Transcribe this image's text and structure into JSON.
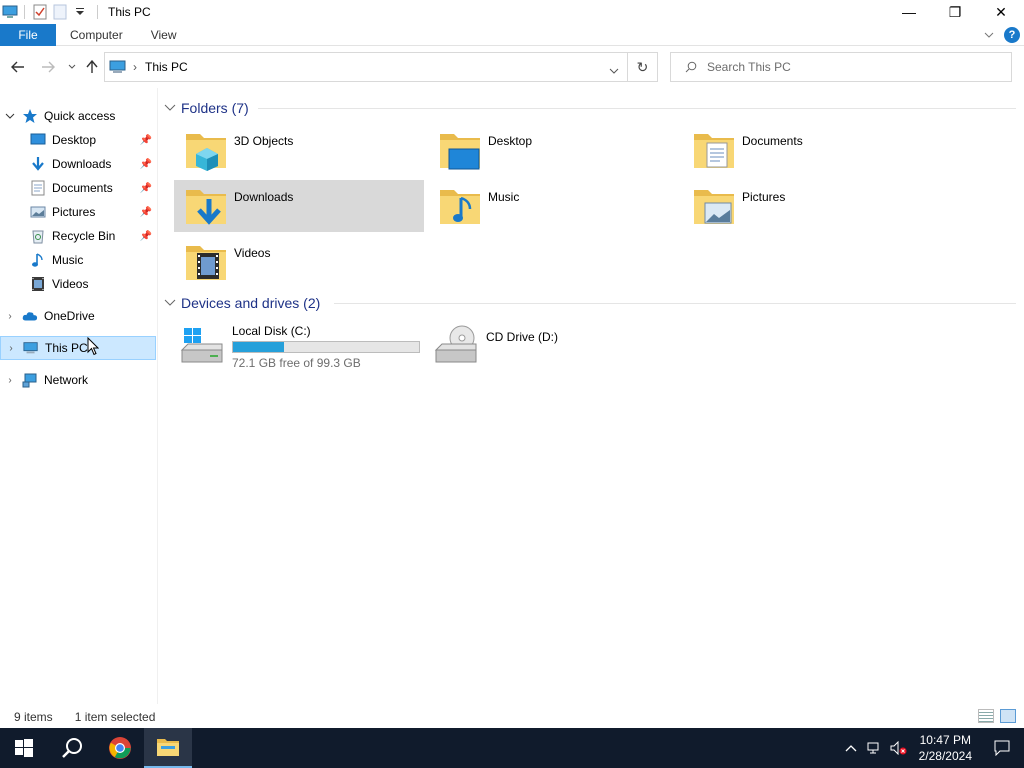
{
  "window": {
    "title": "This PC",
    "controls": {
      "minimize": "—",
      "restore": "❐",
      "close": "✕"
    }
  },
  "ribbon": {
    "tabs": [
      {
        "label": "File"
      },
      {
        "label": "Computer"
      },
      {
        "label": "View"
      }
    ],
    "help": "?"
  },
  "address": {
    "path_segment": "This PC",
    "search_placeholder": "Search This PC"
  },
  "nav": {
    "quick_access": "Quick access",
    "pinned": [
      {
        "label": "Desktop",
        "icon": "desktop-icon",
        "pinned": true
      },
      {
        "label": "Downloads",
        "icon": "downloads-icon",
        "pinned": true
      },
      {
        "label": "Documents",
        "icon": "documents-icon",
        "pinned": true
      },
      {
        "label": "Pictures",
        "icon": "pictures-icon",
        "pinned": true
      },
      {
        "label": "Recycle Bin",
        "icon": "recycle-bin-icon",
        "pinned": true
      },
      {
        "label": "Music",
        "icon": "music-icon",
        "pinned": false
      },
      {
        "label": "Videos",
        "icon": "videos-icon",
        "pinned": false
      }
    ],
    "onedrive": "OneDrive",
    "this_pc": "This PC",
    "network": "Network"
  },
  "content": {
    "folders_header": "Folders (7)",
    "folders": [
      {
        "label": "3D Objects",
        "overlay": "3d-objects-icon"
      },
      {
        "label": "Desktop",
        "overlay": "desktop-icon"
      },
      {
        "label": "Documents",
        "overlay": "documents-icon"
      },
      {
        "label": "Downloads",
        "overlay": "downloads-icon",
        "selected": true
      },
      {
        "label": "Music",
        "overlay": "music-icon"
      },
      {
        "label": "Pictures",
        "overlay": "pictures-icon"
      },
      {
        "label": "Videos",
        "overlay": "videos-icon"
      }
    ],
    "drives_header": "Devices and drives (2)",
    "drives": [
      {
        "label": "Local Disk (C:)",
        "free_text": "72.1 GB free of 99.3 GB",
        "used_fraction": 0.274
      },
      {
        "label": "CD Drive (D:)"
      }
    ]
  },
  "status": {
    "item_count": "9 items",
    "selection": "1 item selected"
  },
  "taskbar": {
    "time": "10:47 PM",
    "date": "2/28/2024"
  },
  "colors": {
    "accent": "#1979ca",
    "selection_bg": "#cce8ff",
    "group_header": "#1e3287",
    "folder": "#f8d775",
    "taskbar": "#101b2c",
    "drive_bar": "#26a0da"
  }
}
